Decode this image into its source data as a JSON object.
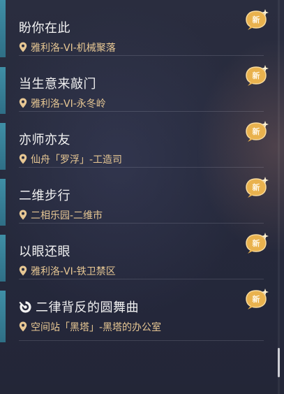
{
  "quest_list": {
    "items": [
      {
        "title": "盼你在此",
        "location": "雅利洛-VI-机械聚落",
        "badge": "新",
        "title_icon": ""
      },
      {
        "title": "当生意来敲门",
        "location": "雅利洛-VI-永冬岭",
        "badge": "新",
        "title_icon": ""
      },
      {
        "title": "亦师亦友",
        "location": "仙舟「罗浮」-工造司",
        "badge": "新",
        "title_icon": ""
      },
      {
        "title": "二维步行",
        "location": "二相乐园-二维市",
        "badge": "新",
        "title_icon": ""
      },
      {
        "title": "以眼还眼",
        "location": "雅利洛-VI-铁卫禁区",
        "badge": "新",
        "title_icon": ""
      },
      {
        "title": "二律背反的圆舞曲",
        "location": "空间站「黑塔」-黑塔的办公室",
        "badge": "新",
        "title_icon": "trailblaze-mission-icon"
      }
    ]
  },
  "colors": {
    "accent_bar": "#3f8fa6",
    "location_text": "#e8c894",
    "badge_gold": "#e9b24e"
  },
  "scrollbar": {
    "position_fraction": 0.92
  }
}
